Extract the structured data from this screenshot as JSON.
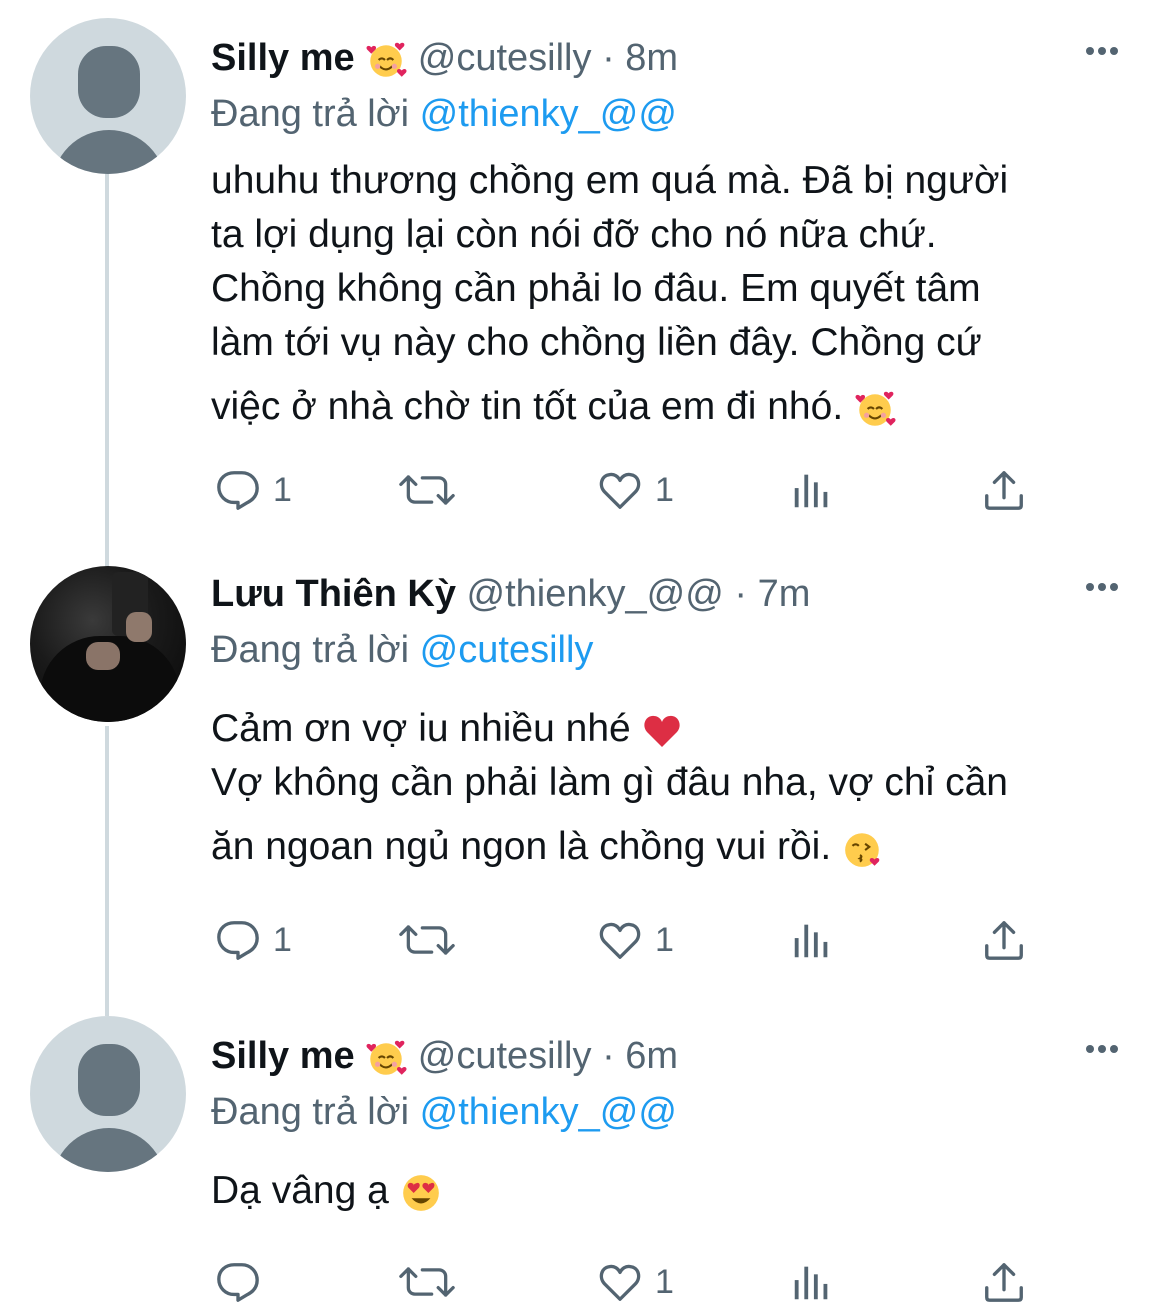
{
  "tweets": [
    {
      "name": "Silly me",
      "name_emoji": "smiling-face-with-hearts",
      "handle": "@cutesilly",
      "dot": "·",
      "time": "8m",
      "reply_prefix": "Đang trả lời",
      "reply_to": "@thienky_@@",
      "lines": [
        "uhuhu thương chồng em quá mà. Đã bị người",
        "ta lợi dụng lại còn nói đỡ cho nó nữa chứ.",
        "Chồng không cần phải lo đâu. Em quyết tâm",
        "làm tới vụ này cho chồng liền đây. Chồng cứ",
        "việc ở nhà chờ tin tốt của em đi nhó."
      ],
      "end_emoji": "smiling-face-with-hearts",
      "reply_count": "1",
      "retweet_count": "",
      "like_count": "1"
    },
    {
      "name": "Lưu Thiên Kỳ",
      "handle": "@thienky_@@",
      "dot": "·",
      "time": "7m",
      "reply_prefix": "Đang trả lời",
      "reply_to": "@cutesilly",
      "lines": [
        "Cảm ơn vợ iu nhiều nhé",
        "Vợ không cần phải làm gì đâu nha, vợ chỉ cần",
        "ăn ngoan ngủ ngon là chồng vui rồi."
      ],
      "line1_emoji": "red-heart",
      "end_emoji": "face-blowing-kiss",
      "reply_count": "1",
      "retweet_count": "",
      "like_count": "1"
    },
    {
      "name": "Silly me",
      "name_emoji": "smiling-face-with-hearts",
      "handle": "@cutesilly",
      "dot": "·",
      "time": "6m",
      "reply_prefix": "Đang trả lời",
      "reply_to": "@thienky_@@",
      "lines": [
        "Dạ vâng ạ"
      ],
      "end_emoji": "smiling-face-with-heart-eyes",
      "reply_count": "",
      "retweet_count": "",
      "like_count": "1"
    }
  ],
  "colors": {
    "text": "#0f1419",
    "secondary": "#536471",
    "link": "#1d9bf0",
    "thread_line": "#cfd9de"
  }
}
